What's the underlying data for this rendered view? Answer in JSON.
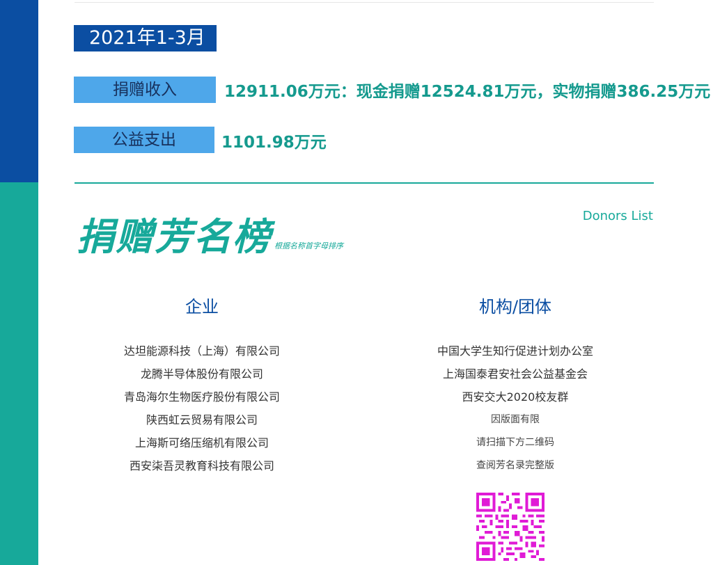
{
  "period": "2021年1-3月",
  "income": {
    "label": "捐赠收入",
    "value": "12911.06万元：现金捐赠12524.81万元，实物捐赠386.25万元"
  },
  "expense": {
    "label": "公益支出",
    "value": "1101.98万元"
  },
  "donor_list": {
    "title": "捐赠芳名榜",
    "sort_note": "根据名称首字母排序",
    "title_en": "Donors List"
  },
  "enterprises": {
    "heading": "企业",
    "items": [
      "达坦能源科技（上海）有限公司",
      "龙腾半导体股份有限公司",
      "青岛海尔生物医疗股份有限公司",
      "陕西虹云贸易有限公司",
      "上海斯可络压缩机有限公司",
      "西安柒吾灵教育科技有限公司"
    ]
  },
  "organizations": {
    "heading": "机构/团体",
    "items": [
      "中国大学生知行促进计划办公室",
      "上海国泰君安社会公益基金会",
      "西安交大2020校友群"
    ],
    "notes": [
      "因版面有限",
      "请扫描下方二维码",
      "查阅芳名录完整版"
    ]
  },
  "colors": {
    "blue": "#0b4ea2",
    "teal": "#17a99a",
    "light_blue": "#4ea7ea",
    "qr_magenta": "#e01bd6"
  },
  "icons": {
    "qr": "qr-code-icon"
  }
}
